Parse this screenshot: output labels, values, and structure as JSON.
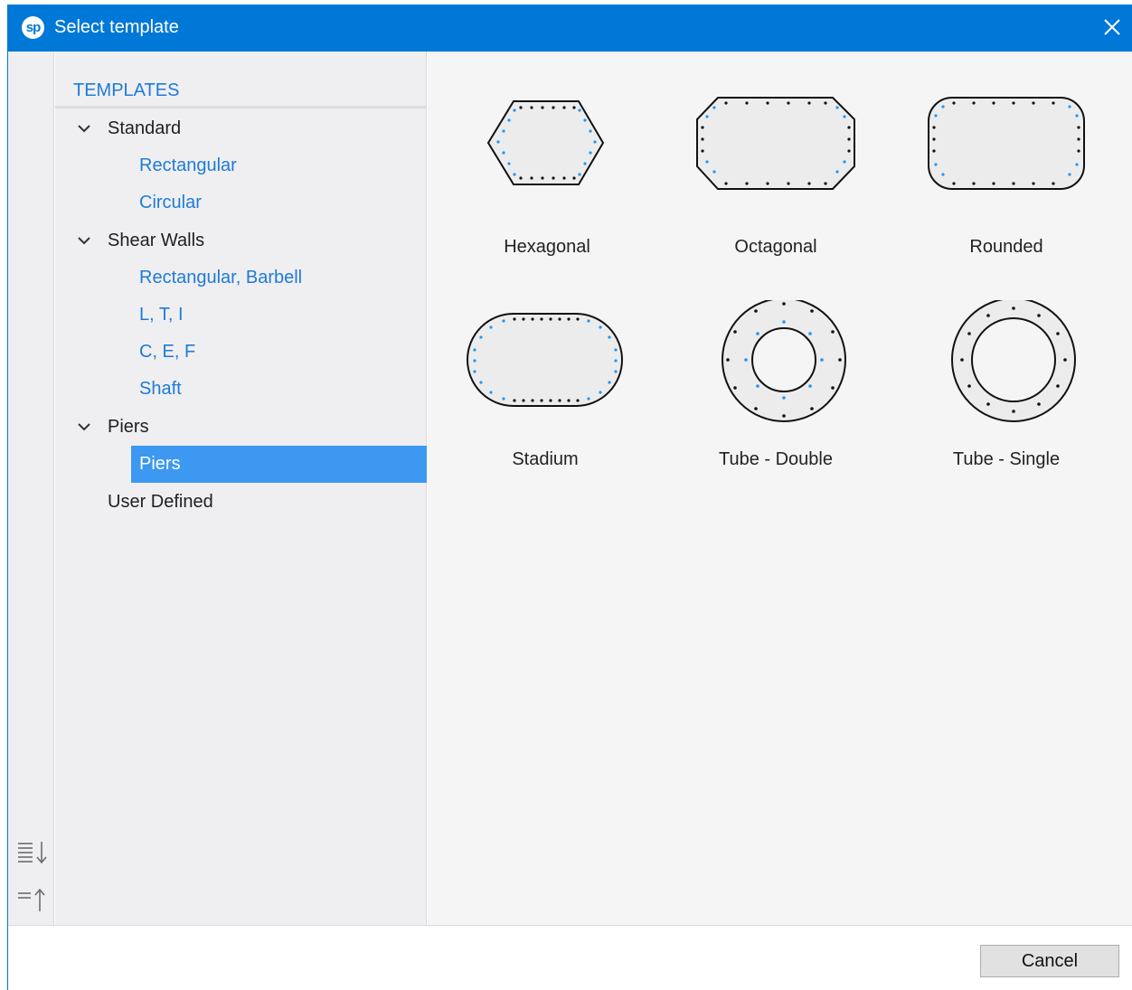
{
  "window": {
    "title": "Select template",
    "logo_text": "sp"
  },
  "tree": {
    "header": "TEMPLATES",
    "groups": [
      {
        "label": "Standard",
        "expanded": true,
        "items": [
          "Rectangular",
          "Circular"
        ]
      },
      {
        "label": "Shear Walls",
        "expanded": true,
        "items": [
          "Rectangular, Barbell",
          "L, T, I",
          "C, E, F",
          "Shaft"
        ]
      },
      {
        "label": "Piers",
        "expanded": true,
        "items": [
          "Piers"
        ],
        "selected_item": "Piers"
      },
      {
        "label": "User Defined",
        "expanded": false,
        "items": []
      }
    ]
  },
  "templates": [
    {
      "name": "Hexagonal",
      "icon": "hexagonal-section-icon"
    },
    {
      "name": "Octagonal",
      "icon": "octagonal-section-icon"
    },
    {
      "name": "Rounded",
      "icon": "rounded-section-icon"
    },
    {
      "name": "Stadium",
      "icon": "stadium-section-icon"
    },
    {
      "name": "Tube - Double",
      "icon": "tube-double-section-icon"
    },
    {
      "name": "Tube - Single",
      "icon": "tube-single-section-icon"
    }
  ],
  "footer": {
    "cancel_label": "Cancel"
  },
  "colors": {
    "title_bar": "#0078d7",
    "accent_text": "#1e7bd6",
    "selection": "#3c98f0",
    "rebar_black": "#111111",
    "rebar_blue": "#2196f3",
    "section_fill": "#ececec"
  }
}
